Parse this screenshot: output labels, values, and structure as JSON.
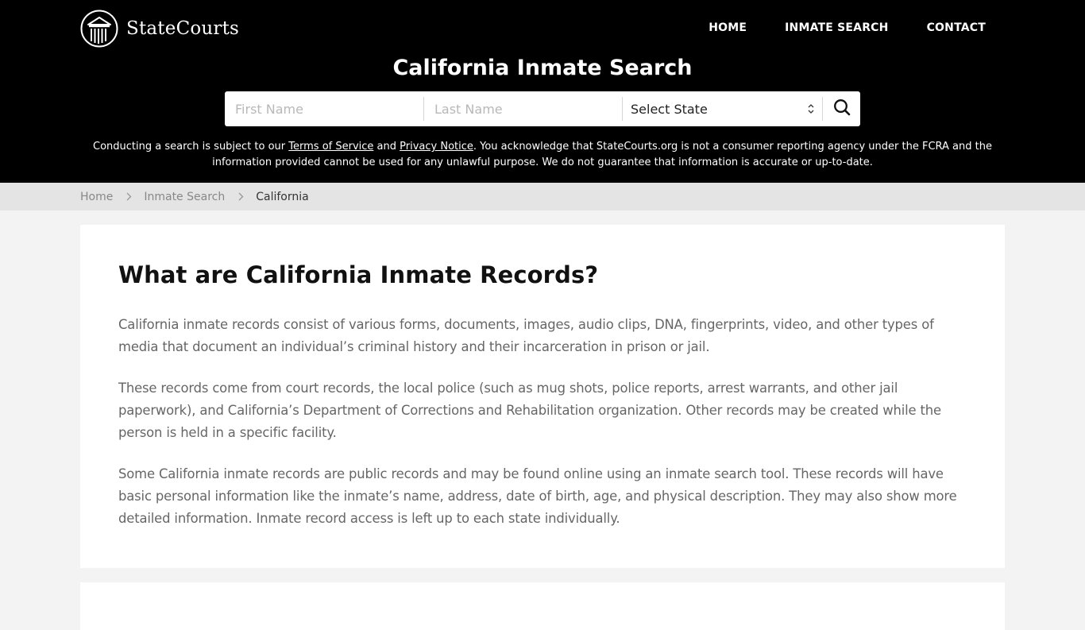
{
  "brand": {
    "name": "StateCourts",
    "logo_icon": "courthouse-columns-icon"
  },
  "nav": {
    "items": [
      {
        "label": "HOME"
      },
      {
        "label": "INMATE SEARCH"
      },
      {
        "label": "CONTACT"
      }
    ]
  },
  "header": {
    "title": "California Inmate Search"
  },
  "search": {
    "first_name_placeholder": "First Name",
    "last_name_placeholder": "Last Name",
    "state_selected": "Select State",
    "state_icon": "select-updown-icon",
    "submit_icon": "search-icon"
  },
  "disclaimer": {
    "line1_prefix": "Conducting a search is subject to our ",
    "terms_link": "Terms of Service",
    "and_text": " and ",
    "privacy_link": "Privacy Notice",
    "line1_suffix": ". You acknowledge that StateCourts.org is not a consumer reporting agency under the FCRA and the",
    "line2": "information provided cannot be used for any unlawful purpose. We do not guarantee that information is accurate or up-to-date."
  },
  "breadcrumb": {
    "items": [
      {
        "label": "Home"
      },
      {
        "label": "Inmate Search"
      },
      {
        "label": "California"
      }
    ],
    "separator_icon": "chevron-right-icon"
  },
  "article": {
    "heading": "What are California Inmate Records?",
    "paragraphs": [
      "California inmate records consist of various forms, documents, images, audio clips, DNA, fingerprints, video, and other types of media that document an individual’s criminal history and their incarceration in prison or jail.",
      "These records come from court records, the local police (such as mug shots, police reports, arrest warrants, and other jail paperwork), and California’s Department of Corrections and Rehabilitation organization. Other records may be created while the person is held in a specific facility.",
      "Some California inmate records are public records and may be found online using an inmate search tool. These records will have basic personal information like the inmate’s name, address, date of birth, age, and physical description. They may also show more detailed information. Inmate record access is left up to each state individually."
    ]
  }
}
